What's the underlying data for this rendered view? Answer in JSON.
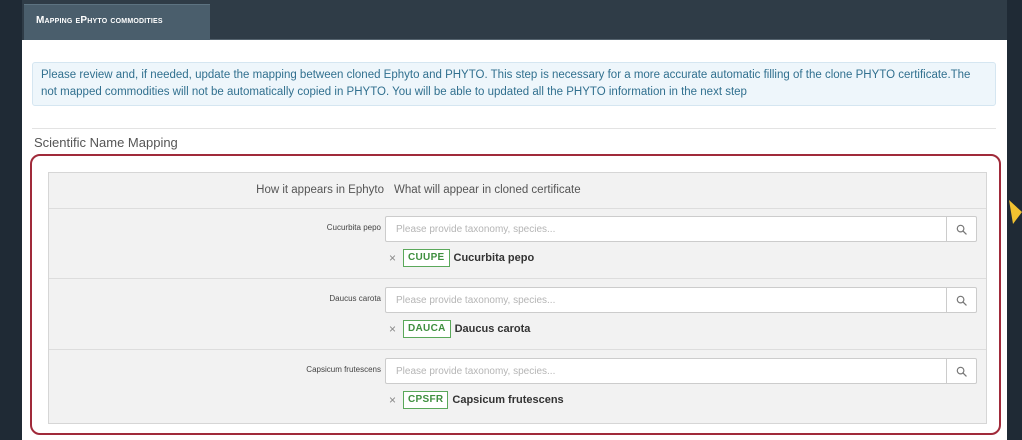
{
  "tab": {
    "label": "Mapping ePhyto commodities"
  },
  "info": {
    "line1": "Please review and, if needed, update the mapping between cloned Ephyto and PHYTO. This step is necessary for a more accurate automatic filling of the clone PHYTO certificate.The",
    "line2": "not mapped commodities will not be automatically copied in PHYTO. You will be able to updated all the PHYTO information in the next step"
  },
  "section": {
    "title": "Scientific Name Mapping"
  },
  "table": {
    "header_left": "How it appears in Ephyto",
    "header_right": "What will appear in cloned certificate",
    "rows": [
      {
        "label": "Cucurbita pepo",
        "placeholder": "Please provide taxonomy, species...",
        "code": "CUUPE",
        "name": "Cucurbita pepo"
      },
      {
        "label": "Daucus carota",
        "placeholder": "Please provide taxonomy, species...",
        "code": "DAUCA",
        "name": "Daucus carota"
      },
      {
        "label": "Capsicum frutescens",
        "placeholder": "Please provide taxonomy, species...",
        "code": "CPSFR",
        "name": "Capsicum frutescens"
      }
    ]
  },
  "icons": {
    "search": "search-icon",
    "remove": "close-icon"
  },
  "colors": {
    "highlight": "#a02a3a",
    "code_badge": "#3f8f3f",
    "info_text": "#31708f",
    "frame": "#1f2a35"
  }
}
